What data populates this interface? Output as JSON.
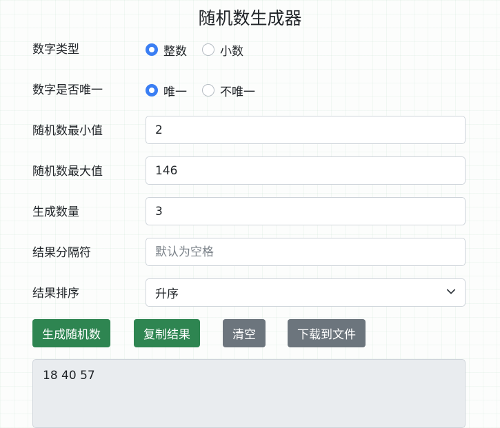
{
  "title": "随机数生成器",
  "number_type": {
    "label": "数字类型",
    "options": [
      "整数",
      "小数"
    ],
    "selected": "整数"
  },
  "unique": {
    "label": "数字是否唯一",
    "options": [
      "唯一",
      "不唯一"
    ],
    "selected": "唯一"
  },
  "min": {
    "label": "随机数最小值",
    "value": "2"
  },
  "max": {
    "label": "随机数最大值",
    "value": "146"
  },
  "count": {
    "label": "生成数量",
    "value": "3"
  },
  "separator": {
    "label": "结果分隔符",
    "value": "",
    "placeholder": "默认为空格"
  },
  "sort": {
    "label": "结果排序",
    "selected": "升序",
    "icon": "chevron-down-icon"
  },
  "buttons": {
    "generate": "生成随机数",
    "copy": "复制结果",
    "clear": "清空",
    "download": "下载到文件"
  },
  "result": "18 40 57",
  "colors": {
    "primary_radio": "#3a7ef3",
    "success": "#2e8551",
    "secondary": "#6c757d"
  }
}
